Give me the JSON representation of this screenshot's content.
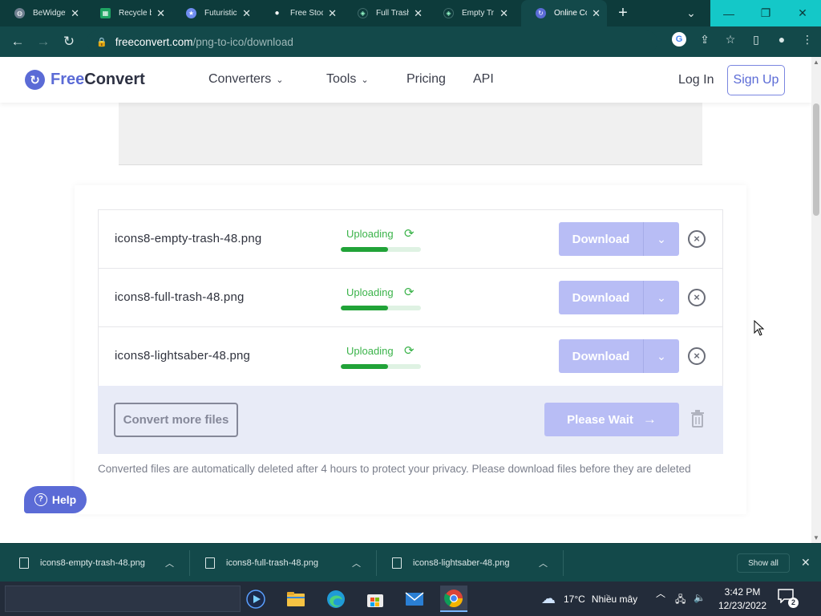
{
  "tabs": [
    {
      "title": "BeWidgets",
      "active": false,
      "icon": "globe-icon"
    },
    {
      "title": "Recycle bin",
      "active": false,
      "icon": "sheets-icon"
    },
    {
      "title": "Futuristic",
      "active": false,
      "icon": "star-icon"
    },
    {
      "title": "Free Stock",
      "active": false,
      "icon": "circle-icon"
    },
    {
      "title": "Full Trash",
      "active": false,
      "icon": "icons8-icon"
    },
    {
      "title": "Empty Tr",
      "active": false,
      "icon": "icons8-icon"
    },
    {
      "title": "Online Co",
      "active": true,
      "icon": "freeconvert-icon"
    }
  ],
  "address": {
    "domain": "freeconvert.com",
    "path": "/png-to-ico/download"
  },
  "site": {
    "logo_free": "Free",
    "logo_convert": "Convert",
    "nav": {
      "converters": "Converters",
      "tools": "Tools",
      "pricing": "Pricing",
      "api": "API"
    },
    "login": "Log In",
    "signup": "Sign Up"
  },
  "files": [
    {
      "name": "icons8-empty-trash-48.png",
      "status": "Uploading",
      "progress": 0.59,
      "download_label": "Download"
    },
    {
      "name": "icons8-full-trash-48.png",
      "status": "Uploading",
      "progress": 0.59,
      "download_label": "Download"
    },
    {
      "name": "icons8-lightsaber-48.png",
      "status": "Uploading",
      "progress": 0.59,
      "download_label": "Download"
    }
  ],
  "actions": {
    "convert_more": "Convert more files",
    "please_wait": "Please Wait"
  },
  "note": "Converted files are automatically deleted after 4 hours to protect your privacy. Please download files before they are deleted",
  "help_label": "Help",
  "downloads": [
    {
      "name": "icons8-empty-trash-48.png"
    },
    {
      "name": "icons8-full-trash-48.png"
    },
    {
      "name": "icons8-lightsaber-48.png"
    }
  ],
  "show_all": "Show all",
  "taskbar": {
    "weather_temp": "17°C",
    "weather_text": "Nhiều mây",
    "time": "3:42 PM",
    "date": "12/23/2022",
    "notification_count": "2"
  },
  "colors": {
    "accent": "#5b6bd6",
    "disabled_button": "#b8bdf5",
    "progress": "#21a338",
    "status_text": "#3bb34a",
    "browser_frame": "#13494a"
  }
}
